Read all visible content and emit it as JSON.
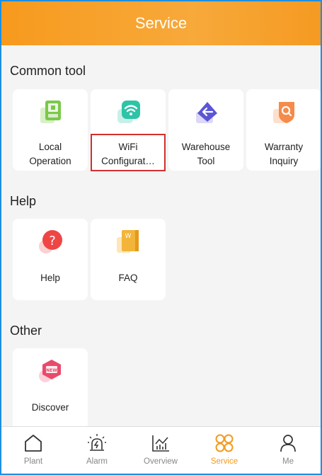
{
  "header": {
    "title": "Service"
  },
  "sections": {
    "common": {
      "title": "Common tool",
      "items": [
        {
          "label": "Local\nOperation",
          "icon": "local-operation-icon"
        },
        {
          "label": "WiFi\nConfigurat…",
          "icon": "wifi-config-icon"
        },
        {
          "label": "Warehouse\nTool",
          "icon": "warehouse-tool-icon"
        },
        {
          "label": "Warranty\nInquiry",
          "icon": "warranty-inquiry-icon"
        }
      ]
    },
    "help": {
      "title": "Help",
      "items": [
        {
          "label": "Help",
          "icon": "help-icon"
        },
        {
          "label": "FAQ",
          "icon": "faq-icon"
        }
      ]
    },
    "other": {
      "title": "Other",
      "items": [
        {
          "label": "Discover",
          "icon": "discover-new-icon"
        }
      ]
    }
  },
  "tabbar": {
    "items": [
      {
        "label": "Plant",
        "icon": "home-icon",
        "active": false
      },
      {
        "label": "Alarm",
        "icon": "alarm-icon",
        "active": false
      },
      {
        "label": "Overview",
        "icon": "chart-icon",
        "active": false
      },
      {
        "label": "Service",
        "icon": "service-grid-icon",
        "active": true
      },
      {
        "label": "Me",
        "icon": "user-icon",
        "active": false
      }
    ]
  },
  "colors": {
    "accent": "#f39a1e",
    "highlight": "#d32f2f",
    "frame": "#1e8fe0"
  }
}
